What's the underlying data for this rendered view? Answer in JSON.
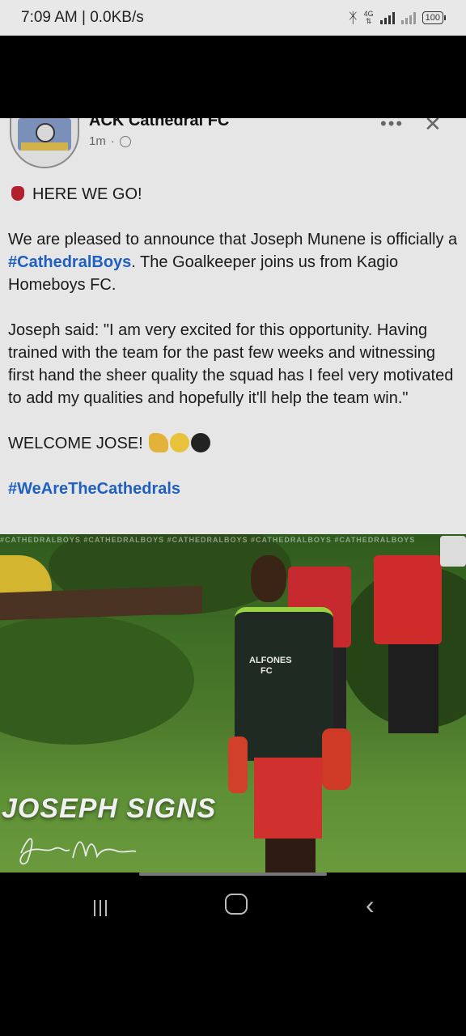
{
  "status_bar": {
    "time": "7:09 AM | 0.0KB/s",
    "network": "4G",
    "battery": "100"
  },
  "post": {
    "page_name": "ACK Cathedral FC",
    "time_ago": "1m",
    "separator": "·",
    "headline": "HERE WE GO!",
    "para1_pre": "We are pleased to announce that Joseph Munene is officially a ",
    "para1_hashtag": "#CathedralBoys",
    "para1_post": ". The Goalkeeper joins us from Kagio Homeboys FC.",
    "quote": "Joseph said: \"I am very excited for this opportunity. Having trained with the team for the past few weeks and witnessing first hand the sheer quality the squad has I feel very motivated to add my qualities and hopefully it'll help the team win.\"",
    "welcome": "WELCOME JOSE!",
    "hashtag2": "#WeAreTheCathedrals"
  },
  "image": {
    "watermark": "#CATHEDRALBOYS #CATHEDRALBOYS #CATHEDRALBOYS #CATHEDRALBOYS #CATHEDRALBOYS",
    "headline": "JOSEPH SIGNS",
    "signature": "Joseph Munene",
    "shirt_text_1": "ALFONES",
    "shirt_text_2": "FC"
  },
  "colors": {
    "hashtag": "#1f5fbf",
    "card_bg": "#e6e6e6"
  }
}
